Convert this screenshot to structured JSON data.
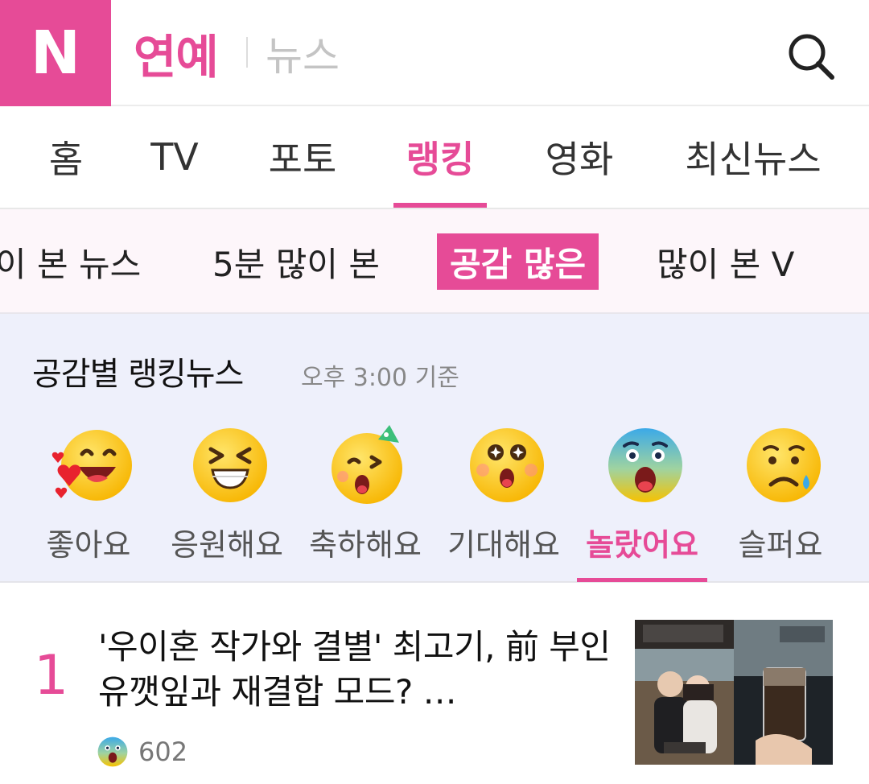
{
  "header": {
    "logo_letter": "N",
    "brand": "연예",
    "subbrand": "뉴스"
  },
  "nav": {
    "items": [
      {
        "label": "홈"
      },
      {
        "label": "TV"
      },
      {
        "label": "포토"
      },
      {
        "label": "랭킹"
      },
      {
        "label": "영화"
      },
      {
        "label": "최신뉴스"
      }
    ],
    "active": "랭킹"
  },
  "subnav": {
    "items": [
      {
        "label": "이 본 뉴스"
      },
      {
        "label": "5분 많이 본"
      },
      {
        "label": "공감 많은"
      },
      {
        "label": "많이 본 V"
      }
    ],
    "active": "공감 많은"
  },
  "ranking": {
    "title": "공감별 랭킹뉴스",
    "time": "오후 3:00 기준",
    "reactions": [
      {
        "label": "좋아요",
        "icon": "love-emoji-icon"
      },
      {
        "label": "응원해요",
        "icon": "cheer-emoji-icon"
      },
      {
        "label": "축하해요",
        "icon": "congrats-emoji-icon"
      },
      {
        "label": "기대해요",
        "icon": "expect-emoji-icon"
      },
      {
        "label": "놀랐어요",
        "icon": "surprised-emoji-icon"
      },
      {
        "label": "슬퍼요",
        "icon": "sad-emoji-icon"
      }
    ],
    "active": "놀랐어요"
  },
  "articles": [
    {
      "rank": "1",
      "headline": "'우이혼 작가와 결별' 최고기, 前 부인 유깻잎과 재결합 모드? …",
      "reaction_icon": "surprised-emoji-icon",
      "count": "602"
    }
  ],
  "colors": {
    "accent": "#e64b97",
    "panel_bg": "#eef0fb",
    "subnav_bg": "#fdf6fa"
  }
}
